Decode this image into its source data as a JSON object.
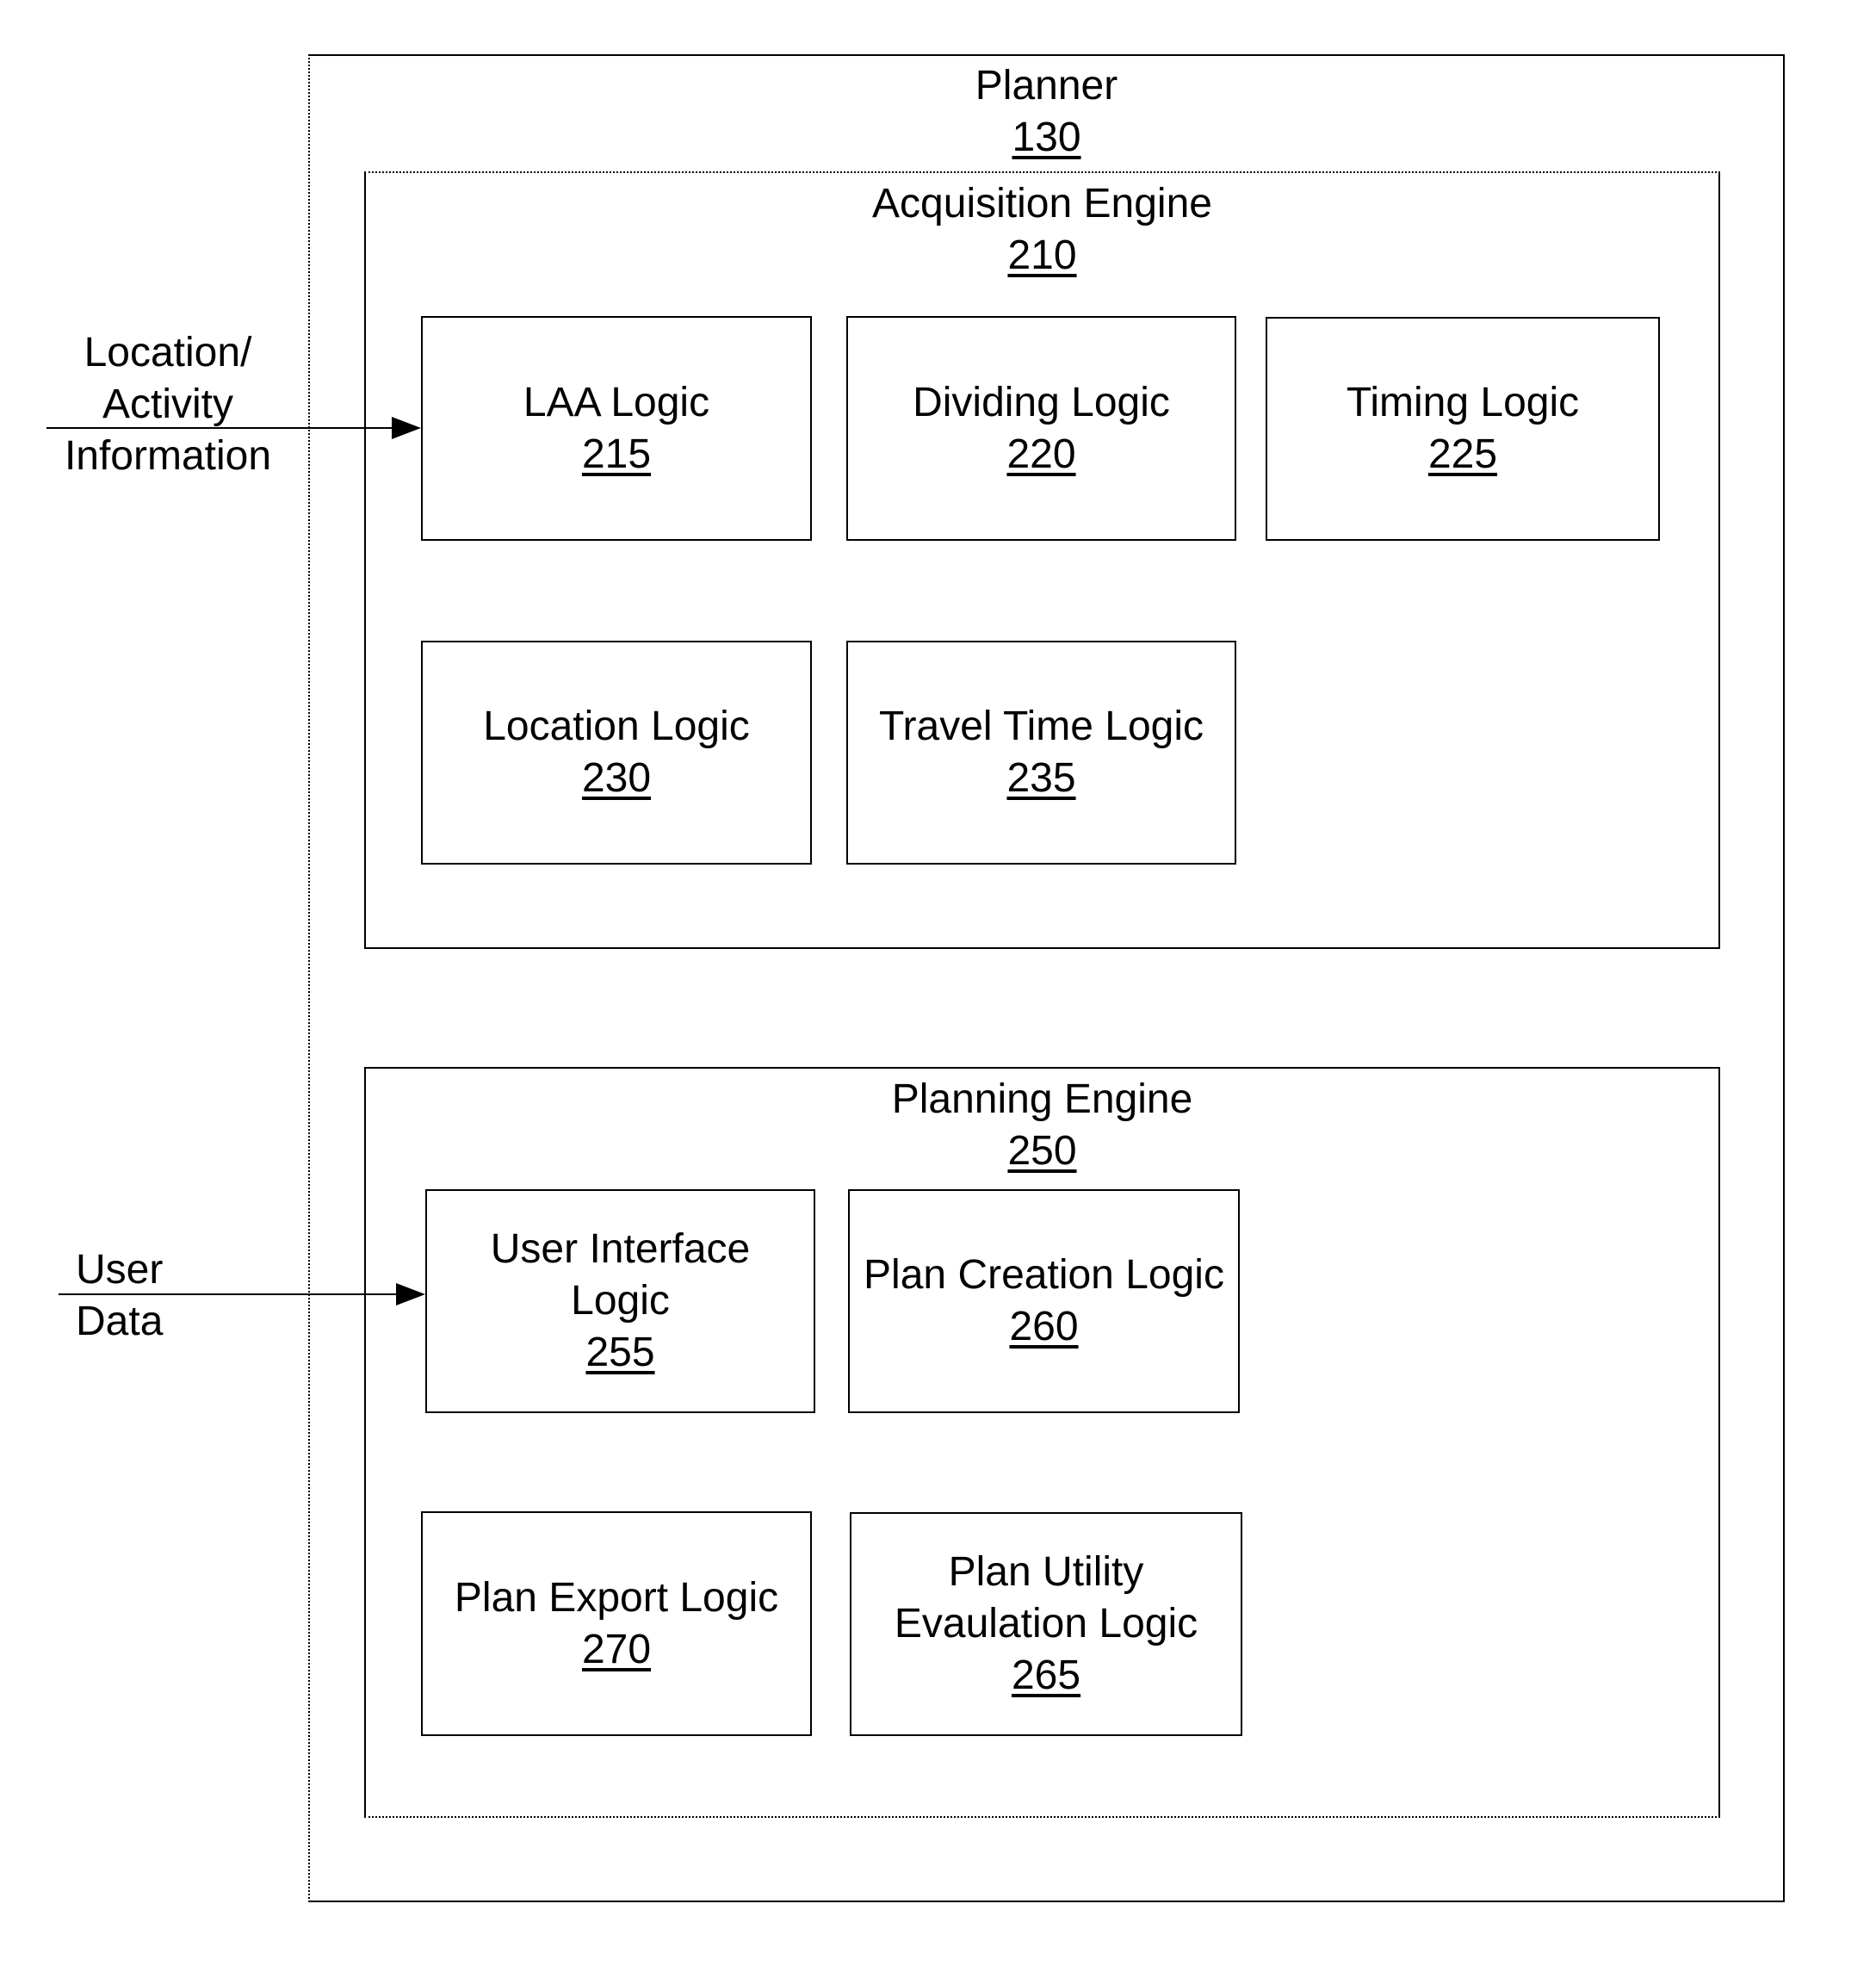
{
  "planner": {
    "title": "Planner",
    "number": "130"
  },
  "acquisition_engine": {
    "title": "Acquisition Engine",
    "number": "210",
    "modules": [
      {
        "name": "LAA Logic",
        "number": "215"
      },
      {
        "name": "Dividing Logic",
        "number": "220"
      },
      {
        "name": "Timing Logic",
        "number": "225"
      },
      {
        "name": "Location Logic",
        "number": "230"
      },
      {
        "name": "Travel Time Logic",
        "number": "235"
      }
    ]
  },
  "planning_engine": {
    "title": "Planning Engine",
    "number": "250",
    "modules": [
      {
        "name_line1": "User Interface",
        "name_line2": "Logic",
        "number": "255"
      },
      {
        "name": "Plan Creation Logic",
        "number": "260"
      },
      {
        "name": "Plan Export Logic",
        "number": "270"
      },
      {
        "name_line1": "Plan Utility",
        "name_line2": "Evaulation Logic",
        "number": "265"
      }
    ]
  },
  "inputs": {
    "location_activity": {
      "line1": "Location/",
      "line2": "Activity",
      "line3": "Information"
    },
    "user_data": {
      "line1": "User",
      "line2": "Data"
    }
  }
}
